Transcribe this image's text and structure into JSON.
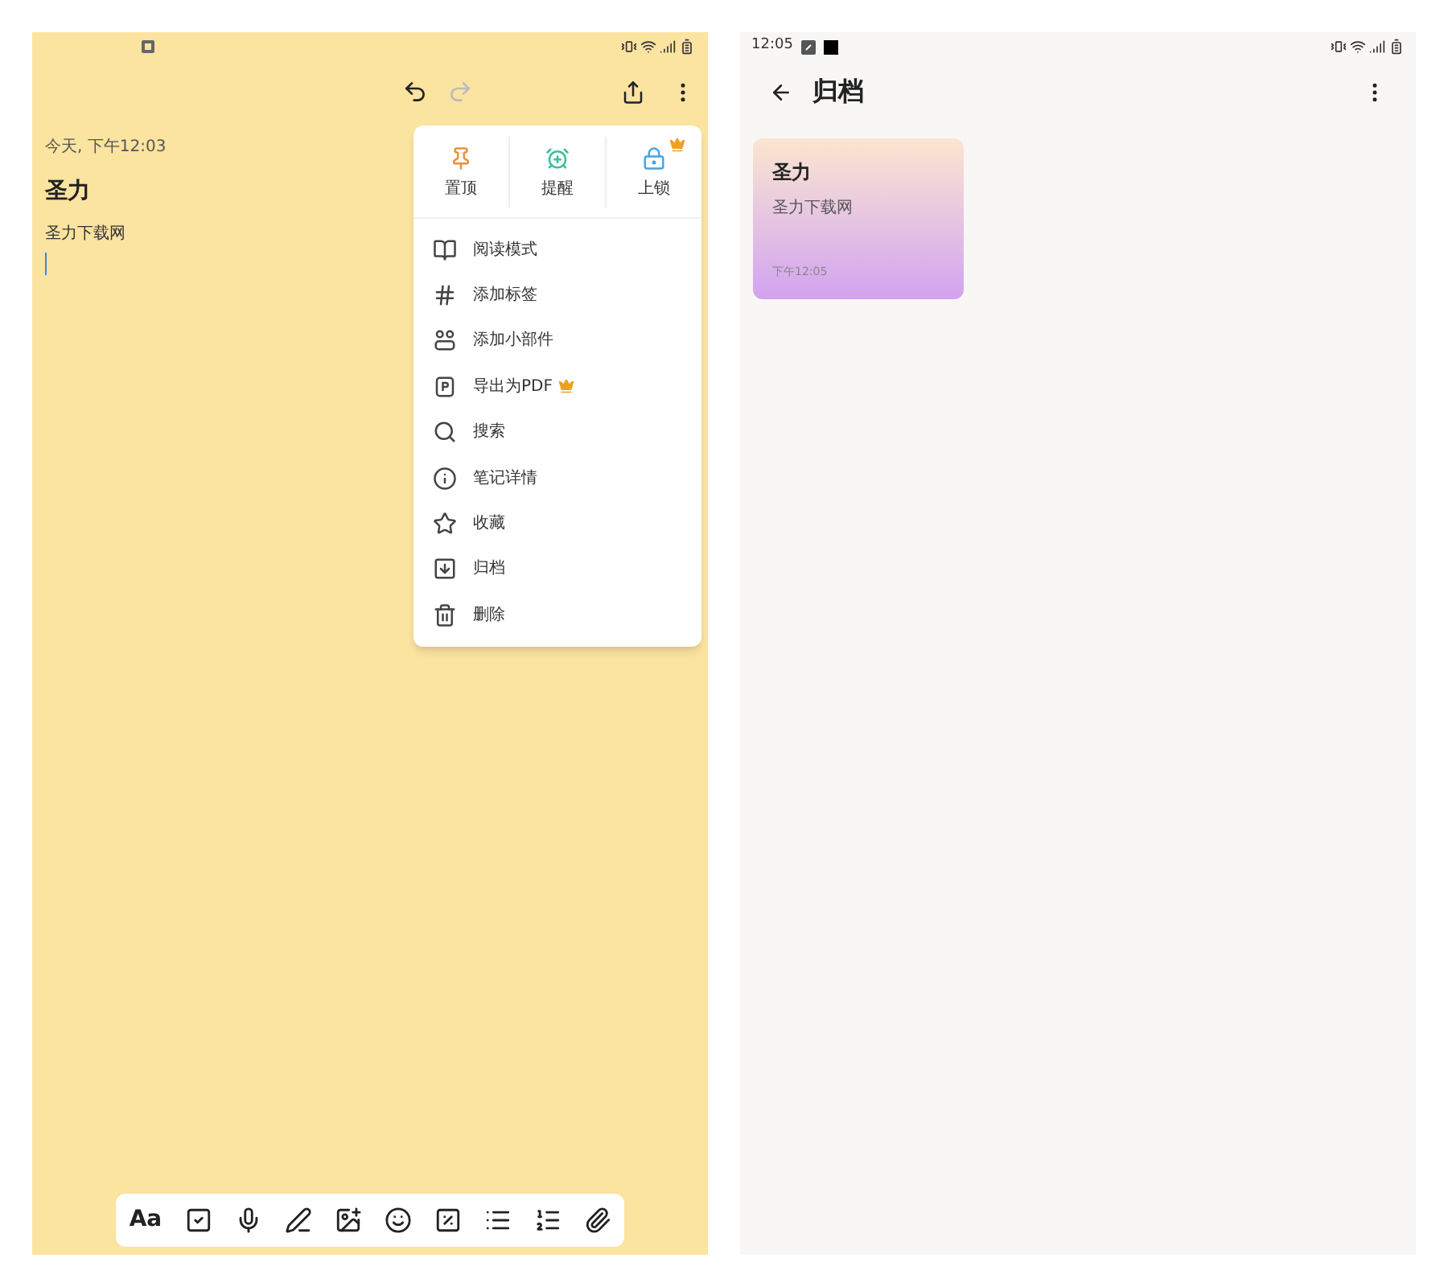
{
  "editor": {
    "date": "今天, 下午12:03",
    "title": "圣力",
    "body": "圣力下载网",
    "menu": {
      "quick_actions": [
        {
          "kind": "pin",
          "label": "置顶",
          "premium": false
        },
        {
          "kind": "alarm",
          "label": "提醒",
          "premium": false
        },
        {
          "kind": "lock",
          "label": "上锁",
          "premium": true
        }
      ],
      "items": [
        {
          "kind": "book",
          "label": "阅读模式",
          "premium": false
        },
        {
          "kind": "hash",
          "label": "添加标签",
          "premium": false
        },
        {
          "kind": "widget",
          "label": "添加小部件",
          "premium": false
        },
        {
          "kind": "pdf",
          "label": "导出为PDF",
          "premium": true
        },
        {
          "kind": "search",
          "label": "搜索",
          "premium": false
        },
        {
          "kind": "info",
          "label": "笔记详情",
          "premium": false
        },
        {
          "kind": "star",
          "label": "收藏",
          "premium": false
        },
        {
          "kind": "archive",
          "label": "归档",
          "premium": false
        },
        {
          "kind": "trash",
          "label": "删除",
          "premium": false
        }
      ]
    },
    "toolbar": [
      {
        "kind": "text",
        "label": "Aa"
      },
      {
        "kind": "checkbox"
      },
      {
        "kind": "mic"
      },
      {
        "kind": "pen"
      },
      {
        "kind": "image"
      },
      {
        "kind": "emoji"
      },
      {
        "kind": "percent"
      },
      {
        "kind": "bullets"
      },
      {
        "kind": "numbers"
      },
      {
        "kind": "clip"
      }
    ]
  },
  "archive": {
    "status_bar": {
      "time": "12:05"
    },
    "title": "归档",
    "notes": [
      {
        "title": "圣力",
        "body": "圣力下载网",
        "time": "下午12:05"
      }
    ]
  }
}
